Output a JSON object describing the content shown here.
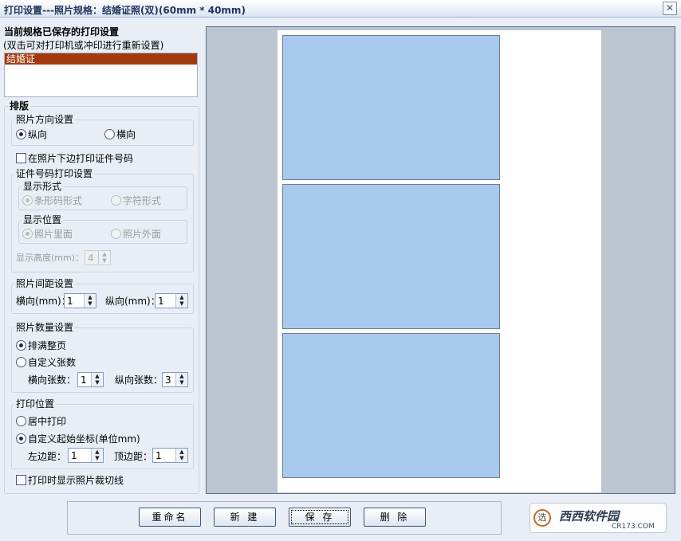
{
  "window": {
    "title": "打印设置---照片规格：结婚证照(双)(60mm * 40mm)",
    "close_glyph": "✕"
  },
  "saved": {
    "heading": "当前规格已保存的打印设置",
    "hint": "(双击可对打印机或冲印进行重新设置)",
    "items": [
      "结婚证"
    ]
  },
  "layout_group": {
    "label": "排版",
    "orientation": {
      "label": "照片方向设置",
      "portrait": "纵向",
      "landscape": "横向",
      "selected": "纵向"
    },
    "print_id_checkbox": "在照片下边打印证件号码",
    "id_print": {
      "label": "证件号码打印设置",
      "display_form": {
        "label": "显示形式",
        "barcode": "条形码形式",
        "text": "字符形式"
      },
      "display_position": {
        "label": "显示位置",
        "inside": "照片里面",
        "outside": "照片外面"
      },
      "height_label": "显示高度(mm)：",
      "height_value": "4"
    },
    "spacing": {
      "label": "照片间距设置",
      "h_label": "横向(mm)：",
      "h_value": "1",
      "v_label": "纵向(mm)：",
      "v_value": "1"
    },
    "quantity": {
      "label": "照片数量设置",
      "fill_page": "排满整页",
      "custom": "自定义张数",
      "h_count_label": "横向张数：",
      "h_count": "1",
      "v_count_label": "纵向张数：",
      "v_count": "3",
      "selected": "排满整页"
    },
    "print_position": {
      "label": "打印位置",
      "center": "居中打印",
      "custom": "自定义起始坐标(单位mm)",
      "left_label": "左边距：",
      "left_value": "1",
      "top_label": "顶边距：",
      "top_value": "1",
      "selected": "自定义起始坐标(单位mm)"
    },
    "show_cut_lines": "打印时显示照片裁切线"
  },
  "preview": {
    "photo_count": 3,
    "photo_color": "#a7c9ee"
  },
  "buttons": {
    "rename": "重命名",
    "new": "新 建",
    "save": "保 存",
    "delete": "删 除"
  },
  "watermark": {
    "badge": "选",
    "brand": "西西软件园",
    "url": "CR173.COM"
  }
}
